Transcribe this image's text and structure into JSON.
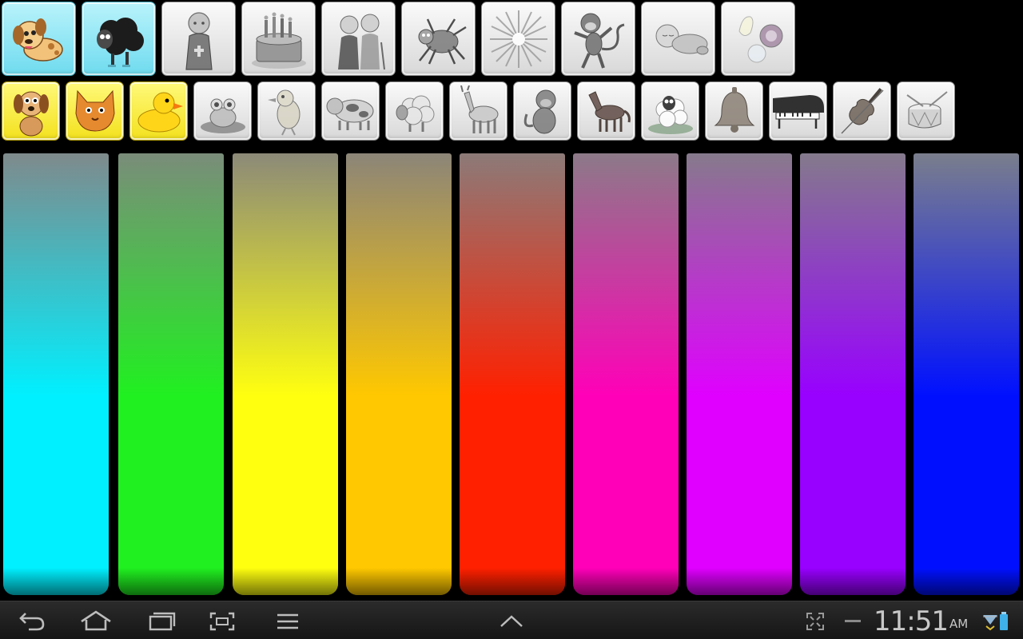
{
  "app": {
    "row1_tiles": [
      {
        "icon": "puppy-icon",
        "style": "selected-cyan"
      },
      {
        "icon": "black-sheep-icon",
        "style": "selected-cyan"
      },
      {
        "icon": "monk-icon",
        "style": "gray"
      },
      {
        "icon": "birthday-cake-icon",
        "style": "gray"
      },
      {
        "icon": "old-couple-icon",
        "style": "gray"
      },
      {
        "icon": "spider-icon",
        "style": "gray"
      },
      {
        "icon": "starburst-icon",
        "style": "gray"
      },
      {
        "icon": "monkey-icon",
        "style": "gray"
      },
      {
        "icon": "sleeping-baby-icon",
        "style": "gray"
      },
      {
        "icon": "seashells-icon",
        "style": "gray"
      }
    ],
    "row2_tiles": [
      {
        "icon": "dog-icon",
        "style": "selected-yellow"
      },
      {
        "icon": "cat-icon",
        "style": "selected-yellow"
      },
      {
        "icon": "duck-icon",
        "style": "selected-yellow"
      },
      {
        "icon": "frog-icon",
        "style": "gray"
      },
      {
        "icon": "bird-icon",
        "style": "gray"
      },
      {
        "icon": "cow-icon",
        "style": "gray"
      },
      {
        "icon": "sheep-icon",
        "style": "gray"
      },
      {
        "icon": "donkey-icon",
        "style": "gray"
      },
      {
        "icon": "monkey-sitting-icon",
        "style": "gray"
      },
      {
        "icon": "horse-icon",
        "style": "gray"
      },
      {
        "icon": "lamb-icon",
        "style": "gray"
      },
      {
        "icon": "bell-icon",
        "style": "gray"
      },
      {
        "icon": "piano-icon",
        "style": "gray"
      },
      {
        "icon": "violin-icon",
        "style": "gray"
      },
      {
        "icon": "drum-icon",
        "style": "gray"
      }
    ],
    "color_bars": [
      {
        "name": "cyan",
        "top": "#7f8a8c",
        "bottom": "#00f0ff"
      },
      {
        "name": "green",
        "top": "#7a8c7a",
        "bottom": "#20f020"
      },
      {
        "name": "yellow",
        "top": "#8c8a78",
        "bottom": "#ffff10"
      },
      {
        "name": "orange",
        "top": "#8c8578",
        "bottom": "#ffc800"
      },
      {
        "name": "red",
        "top": "#8c7a78",
        "bottom": "#ff2000"
      },
      {
        "name": "pink",
        "top": "#8c7a88",
        "bottom": "#ff00b8"
      },
      {
        "name": "magenta",
        "top": "#867a8c",
        "bottom": "#e000ff"
      },
      {
        "name": "violet",
        "top": "#847a8c",
        "bottom": "#9800ff"
      },
      {
        "name": "blue",
        "top": "#7a7e8c",
        "bottom": "#0010ff"
      }
    ]
  },
  "navbar": {
    "back_icon": "back-icon",
    "home_icon": "home-icon",
    "recents_icon": "recent-apps-icon",
    "screenshot_icon": "screenshot-icon",
    "menu_icon": "menu-icon",
    "up_icon": "chevron-up-icon",
    "fullscreen_icon": "fullscreen-icon",
    "minus_icon": "minus-icon",
    "time": "11:51",
    "ampm": "AM",
    "status_icons": [
      "wifi-icon",
      "battery-icon"
    ]
  }
}
